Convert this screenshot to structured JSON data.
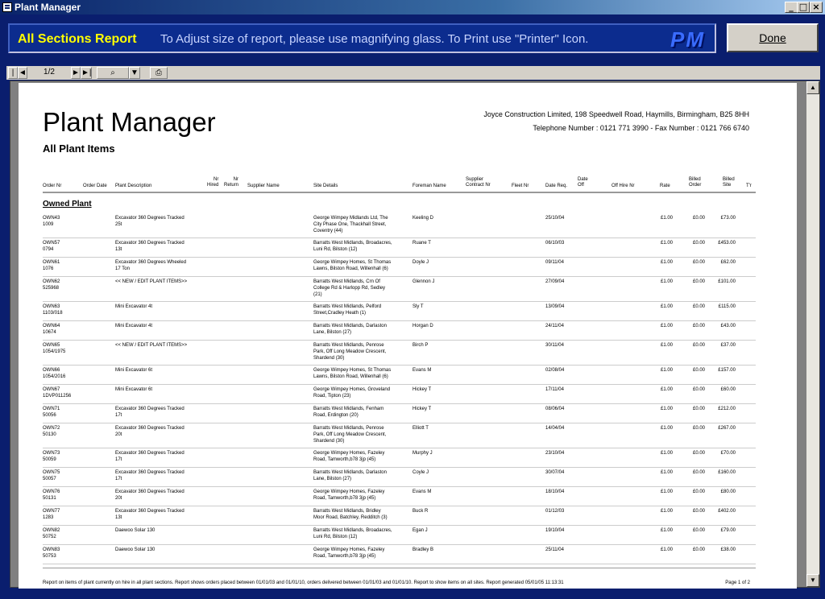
{
  "window": {
    "title": "Plant Manager",
    "min": "_",
    "max": "□",
    "close": "×"
  },
  "banner": {
    "report_title": "All Sections Report",
    "instructions": "To Adjust size of report, please use magnifying glass. To Print use \"Printer\" Icon.",
    "logo": "PM"
  },
  "done_label": "Done",
  "toolbar": {
    "first": "|◄",
    "prev": "◄",
    "page": "1/2",
    "next": "►",
    "last": "►|",
    "zoom": "⌕",
    "zoom_drop": "▼",
    "print": "⎙"
  },
  "report": {
    "company": "Joyce Construction Limited, 198 Speedwell Road, Haymills, Birmingham, B25 8HH",
    "phone": "Telephone Number : 0121 771 3990  -   Fax Number : 0121 766 6740",
    "title": "Plant Manager",
    "subtitle": "All Plant Items",
    "columns": {
      "order_nr": "Order Nr",
      "order_date": "Order Date",
      "plant_desc": "Plant Description",
      "nr_hired": "Nr\nHired",
      "nr_return": "Nr\nReturn",
      "supplier": "Supplier Name",
      "site": "Site Details",
      "foreman": "Foreman Name",
      "supp_contract": "Supplier\nContract Nr",
      "fleet": "Fleet Nr",
      "date_req": "Date Req.",
      "date_off": "Date\nOff",
      "off_hire": "Off Hire Nr",
      "rate": "Rate",
      "billed_order": "Billed\nOrder",
      "billed_site": "Billed\nSite",
      "ttr": "T'r"
    },
    "section": "Owned Plant",
    "rows": [
      {
        "order": "OWN43\n1009",
        "desc": "Excavator 360 Degrees Tracked\n25t",
        "site": "George Wimpey Midlands Ltd, The\nCity Phase One, Thackhall Street,\nCoventry (44)",
        "foreman": "Keeling D",
        "date": "25/10/04",
        "rate": "£1.00",
        "bo": "£0.00",
        "bs": "£73.00"
      },
      {
        "order": "OWN57\n0794",
        "desc": "Excavator 360 Degrees Tracked\n13t",
        "site": "Barratts West Midlands, Broadacres,\nLuni Rd, Bilston (12)",
        "foreman": "Ruane T",
        "date": "06/10/03",
        "rate": "£1.00",
        "bo": "£0.00",
        "bs": "£453.00"
      },
      {
        "order": "OWN61\n1076",
        "desc": "Excavator 360 Degrees Wheeled\n17 Ton",
        "site": "George Wimpey Homes, St Thomas\nLawns, Bilston Road, Willenhall (6)",
        "foreman": "Doyle J",
        "date": "09/11/04",
        "rate": "£1.00",
        "bo": "£0.00",
        "bs": "£62.00"
      },
      {
        "order": "OWN62\n525968",
        "desc": "<< NEW / EDIT PLANT ITEMS>>",
        "site": "Barratts West Midlands, Crn Of\nCollege Rd & Harlopp Rd, Sedley\n(21)",
        "foreman": "Glennon J",
        "date": "27/09/04",
        "rate": "£1.00",
        "bo": "£0.00",
        "bs": "£101.00"
      },
      {
        "order": "OWN63\n1103/018",
        "desc": "Mini Excavator 4t",
        "site": "Barratts West Midlands, Pelford\nStreet,Cradley Heath (1)",
        "foreman": "Sly T",
        "date": "13/09/04",
        "rate": "£1.00",
        "bo": "£0.00",
        "bs": "£115.00"
      },
      {
        "order": "OWN64\n10674",
        "desc": "Mini Excavator 4t",
        "site": "Barratts West Midlands, Darlaston\nLane, Bilston (27)",
        "foreman": "Horgan D",
        "date": "24/11/04",
        "rate": "£1.00",
        "bo": "£0.00",
        "bs": "£43.00"
      },
      {
        "order": "OWN65\n1054/1975",
        "desc": "<< NEW / EDIT PLANT ITEMS>>",
        "site": "Barratts West Midlands, Penrose\nPark, Off Long Meadow Crescent,\nShardend (30)",
        "foreman": "Birch P",
        "date": "30/11/04",
        "rate": "£1.00",
        "bo": "£0.00",
        "bs": "£37.00"
      },
      {
        "order": "OWN66\n1054/2016",
        "desc": "Mini Excavator 6t",
        "site": "George Wimpey Homes, St Thomas\nLawns, Bilston Road, Willenhall (6)",
        "foreman": "Evans M",
        "date": "02/08/04",
        "rate": "£1.00",
        "bo": "£0.00",
        "bs": "£157.00"
      },
      {
        "order": "OWN67\n1DVP011256",
        "desc": "Mini Excavator 6t",
        "site": "George Wimpey Homes, Groveland\nRoad, Tipton (23)",
        "foreman": "Hickey T",
        "date": "17/11/04",
        "rate": "£1.00",
        "bo": "£0.00",
        "bs": "£60.00"
      },
      {
        "order": "OWN71\n50056",
        "desc": "Excavator 360 Degrees Tracked\n17t",
        "site": "Barratts West Midlands, Fenham\nRoad, Erdington (20)",
        "foreman": "Hickey T",
        "date": "08/06/04",
        "rate": "£1.00",
        "bo": "£0.00",
        "bs": "£212.00"
      },
      {
        "order": "OWN72\n50130",
        "desc": "Excavator 360 Degrees Tracked\n20t",
        "site": "Barratts West Midlands, Penrose\nPark, Off Long Meadow Crescent,\nShardend (30)",
        "foreman": "Elliott T",
        "date": "14/04/04",
        "rate": "£1.00",
        "bo": "£0.00",
        "bs": "£267.00"
      },
      {
        "order": "OWN73\n50059",
        "desc": "Excavator 360 Degrees Tracked\n17t",
        "site": "George Wimpey Homes, Fazeley\nRoad, Tamworth,b78 3jp (45)",
        "foreman": "Murphy J",
        "date": "23/10/04",
        "rate": "£1.00",
        "bo": "£0.00",
        "bs": "£70.00"
      },
      {
        "order": "OWN75\n50057",
        "desc": "Excavator 360 Degrees Tracked\n17t",
        "site": "Barratts West Midlands, Darlaston\nLane, Bilston (27)",
        "foreman": "Coyle J",
        "date": "30/07/04",
        "rate": "£1.00",
        "bo": "£0.00",
        "bs": "£160.00"
      },
      {
        "order": "OWN76\n50131",
        "desc": "Excavator 360 Degrees Tracked\n20t",
        "site": "George Wimpey Homes, Fazeley\nRoad, Tamworth,b78 3jp (45)",
        "foreman": "Evans M",
        "date": "18/10/04",
        "rate": "£1.00",
        "bo": "£0.00",
        "bs": "£80.00"
      },
      {
        "order": "OWN77\n1283",
        "desc": "Excavator 360 Degrees Tracked\n13t",
        "site": "Barratts West Midlands, Bridley\nMoor Road, Batchley, Redditch (3)",
        "foreman": "Buck R",
        "date": "01/12/03",
        "rate": "£1.00",
        "bo": "£0.00",
        "bs": "£402.00"
      },
      {
        "order": "OWN82\n50752",
        "desc": "Daewoo Solar 130",
        "site": "Barratts West Midlands, Broadacres,\nLuni Rd, Bilston (12)",
        "foreman": "Egan J",
        "date": "19/10/04",
        "rate": "£1.00",
        "bo": "£0.00",
        "bs": "£79.00"
      },
      {
        "order": "OWN83\n50753",
        "desc": "Daewoo Solar 130",
        "site": "George Wimpey Homes, Fazeley\nRoad, Tamworth,b78 3jp (45)",
        "foreman": "Bradley B",
        "date": "25/11/04",
        "rate": "£1.00",
        "bo": "£0.00",
        "bs": "£38.00"
      }
    ],
    "footer_note": "Report on items of plant currently on hire in all plant sections. Report shows orders placed between 01/01/03 and 01/01/10, orders delivered between 01/01/03 and 01/01/10.  Report to show items on all sites.  Report generated 05/01/05 11:13:31",
    "footer_page": "Page 1 of 2"
  },
  "scroll": {
    "up": "▲",
    "down": "▼"
  }
}
